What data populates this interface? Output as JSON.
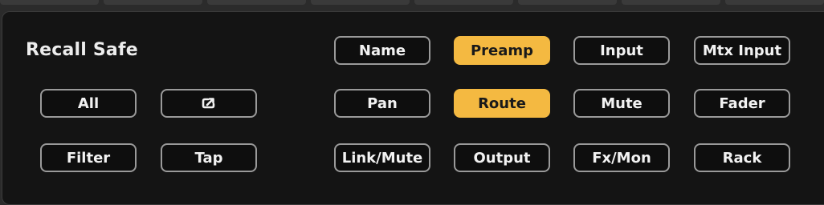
{
  "panel": {
    "title": "Recall Safe"
  },
  "colors": {
    "panel_bg": "#141414",
    "button_border": "#9a9a9a",
    "active": "#f4b941"
  },
  "left_buttons": {
    "all": "All",
    "filter": "Filter",
    "tap": "Tap",
    "export_icon": "export-icon"
  },
  "grid_buttons": {
    "name": {
      "label": "Name",
      "active": false
    },
    "preamp": {
      "label": "Preamp",
      "active": true
    },
    "input": {
      "label": "Input",
      "active": false
    },
    "mtx_input": {
      "label": "Mtx Input",
      "active": false
    },
    "pan": {
      "label": "Pan",
      "active": false
    },
    "route": {
      "label": "Route",
      "active": true
    },
    "mute": {
      "label": "Mute",
      "active": false
    },
    "fader": {
      "label": "Fader",
      "active": false
    },
    "link_mute": {
      "label": "Link/Mute",
      "active": false
    },
    "output": {
      "label": "Output",
      "active": false
    },
    "fx_mon": {
      "label": "Fx/Mon",
      "active": false
    },
    "rack": {
      "label": "Rack",
      "active": false
    }
  }
}
